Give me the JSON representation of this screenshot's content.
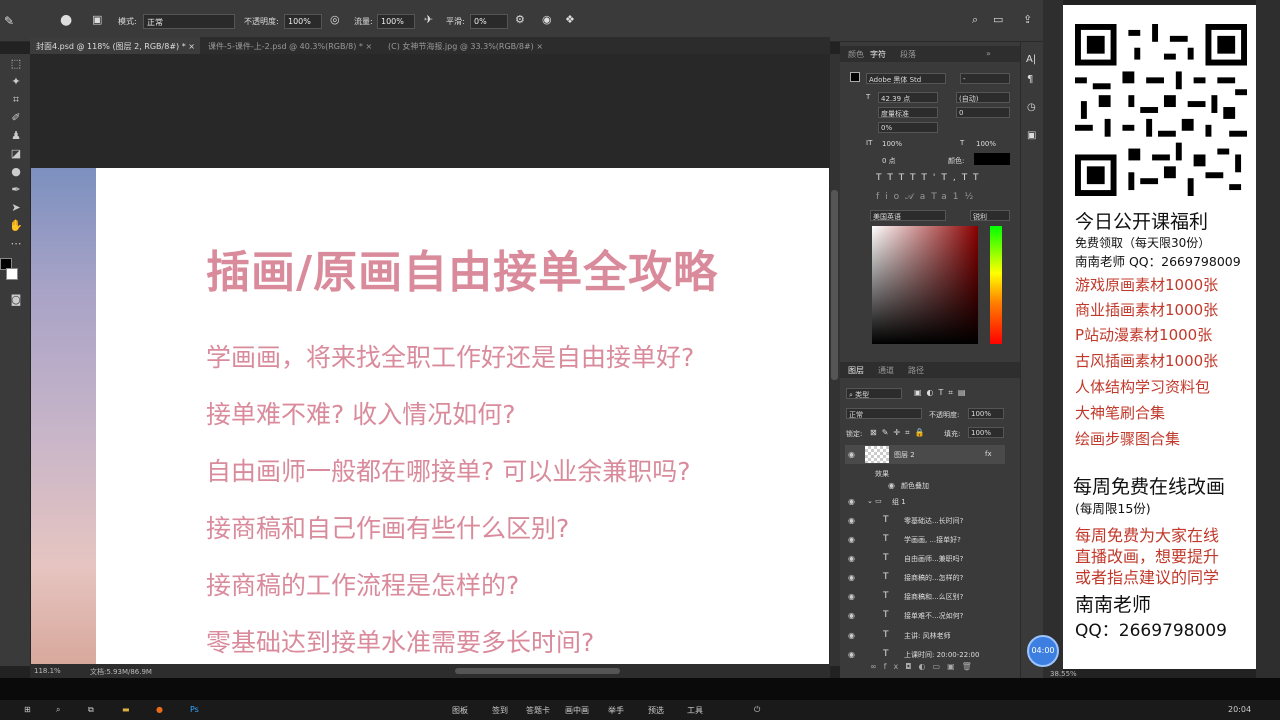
{
  "options_bar": {
    "mode_label": "模式:",
    "mode_value": "正常",
    "opacity_label": "不透明度:",
    "opacity_value": "100%",
    "flow_label": "流量:",
    "flow_value": "100%",
    "smooth_label": "平滑:",
    "smooth_value": "0%"
  },
  "tabs": [
    {
      "label": "封面4.psd @ 118% (图层 2, RGB/8#) *",
      "active": true
    },
    {
      "label": "课件-5-课件-上-2.psd @ 40.3%(RGB/8) *",
      "active": false
    },
    {
      "label": "(C) 女神节海报.jpg @ 33.3%(RGB/8#)",
      "active": false
    }
  ],
  "document": {
    "title": "插画/原画自由接单全攻略",
    "lines": [
      "学画画，将来找全职工作好还是自由接单好?",
      "接单难不难? 收入情况如何?",
      "自由画师一般都在哪接单? 可以业余兼职吗?",
      "接商稿和自己作画有些什么区别?",
      "接商稿的工作流程是怎样的?",
      "零基础达到接单水准需要多长时间?"
    ]
  },
  "status": {
    "zoom": "118.1%",
    "doc": "文档:5.93M/86.9M",
    "right_zoom": "38.55%"
  },
  "char_panel": {
    "tabs": [
      "颜色",
      "字符",
      "段落"
    ],
    "font": "Adobe 黑体 Std",
    "style": "-",
    "size": "42.39 点",
    "leading": "(自动)",
    "kerning": "度量标准",
    "tracking": "0",
    "scale_pct": "0%",
    "vscale": "100%",
    "hscale": "100%",
    "baseline": "0 点",
    "color_label": "颜色:",
    "language": "美国英语",
    "aa": "锐利"
  },
  "layers_panel": {
    "tabs": [
      "图层",
      "通道",
      "路径"
    ],
    "filter": "类型",
    "blend": "正常",
    "opacity_label": "不透明度:",
    "opacity": "100%",
    "lock_label": "锁定:",
    "fill_label": "填充:",
    "fill": "100%",
    "layers": [
      {
        "name": "图层 2",
        "kind": "image",
        "fx": "fx"
      },
      {
        "name": "效果",
        "kind": "effect"
      },
      {
        "name": "颜色叠加",
        "kind": "effect"
      },
      {
        "name": "组 1",
        "kind": "group"
      },
      {
        "name": "零基础达...长时间?",
        "kind": "text"
      },
      {
        "name": "学画画, ...接单好?",
        "kind": "text"
      },
      {
        "name": "自由画师...兼职吗?",
        "kind": "text"
      },
      {
        "name": "接商稿的...怎样的?",
        "kind": "text"
      },
      {
        "name": "接商稿和...么区别?",
        "kind": "text"
      },
      {
        "name": "接单难不...况如何?",
        "kind": "text"
      },
      {
        "name": "主讲: 风林老师",
        "kind": "text"
      },
      {
        "name": "上课时间: 20:00-22:00",
        "kind": "text"
      }
    ]
  },
  "timer": "04:00",
  "promo": {
    "heading": "今日公开课福利",
    "sub1": "免费领取（每天限30份）",
    "sub2": "南南老师 QQ：2669798009",
    "items": [
      "游戏原画素材1000张",
      "商业插画素材1000张",
      "P站动漫素材1000张",
      "古风插画素材1000张",
      "人体结构学习资料包",
      "大神笔刷合集",
      "绘画步骤图合集"
    ],
    "heading2": "每周免费在线改画",
    "limit": "(每周限15份)",
    "desc": [
      "每周免费为大家在线",
      "直播改画，想要提升",
      "或者指点建议的同学"
    ],
    "teacher": "南南老师",
    "qq": "QQ：2669798009"
  },
  "taskbar": {
    "items": [
      "图板",
      "签到",
      "答题卡",
      "画中画",
      "举手",
      "预选",
      "工具"
    ],
    "clock": "20:04"
  },
  "colors": {
    "doc_text": "#d98b9c",
    "promo_red": "#c0392b",
    "accent_blue": "#3d7fe0"
  }
}
